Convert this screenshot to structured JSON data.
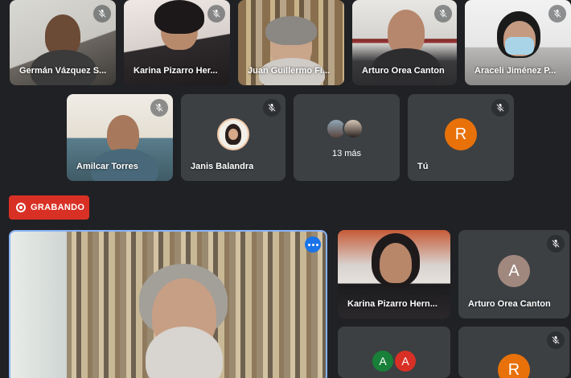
{
  "top_row": [
    {
      "name": "Germán Vázquez S..."
    },
    {
      "name": "Karina Pizarro Her..."
    },
    {
      "name": "Juan Guillermo Fi..."
    },
    {
      "name": "Arturo Orea Canton"
    },
    {
      "name": "Araceli Jiménez P..."
    }
  ],
  "second_row": {
    "amilcar": {
      "name": "Amilcar Torres"
    },
    "janis": {
      "name": "Janis Balandra"
    },
    "more": {
      "label": "13 más"
    },
    "you": {
      "name": "Tú",
      "initial": "R",
      "color": "#e8710a"
    }
  },
  "recording": {
    "label": "GRABANDO",
    "color": "#d93025"
  },
  "right_grid": {
    "karina": {
      "name": "Karina Pizarro Hern..."
    },
    "arturo": {
      "name": "Arturo Orea Canton",
      "initial": "A",
      "color": "#a1887f"
    },
    "group": {
      "initials": [
        "A",
        "A"
      ],
      "colors": [
        "#188038",
        "#d93025"
      ]
    },
    "r_tile": {
      "initial": "R",
      "color": "#e8710a"
    }
  },
  "accent": "#8ab4f8"
}
